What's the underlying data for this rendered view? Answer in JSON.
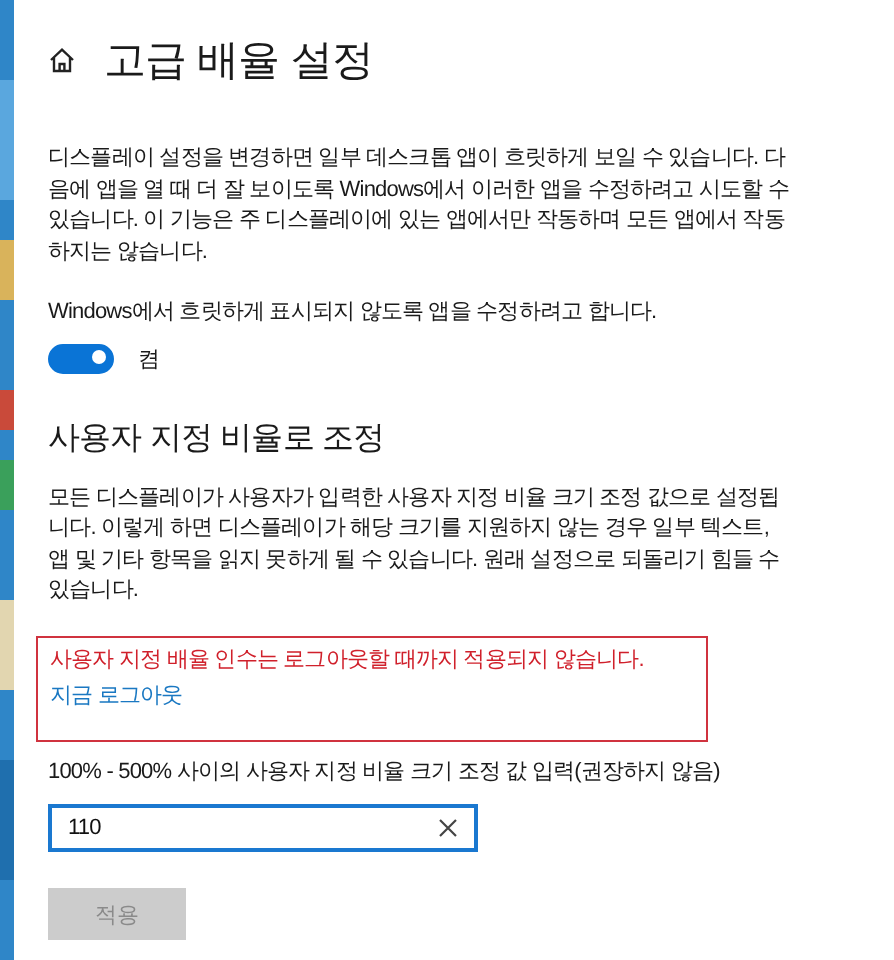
{
  "window": {
    "title": "고급 배율 설정"
  },
  "fix_apps": {
    "description": "디스플레이 설정을 변경하면 일부 데스크톱 앱이 흐릿하게 보일 수 있습니다. 다음에 앱을 열 때 더 잘 보이도록 Windows에서 이러한 앱을 수정하려고 시도할 수 있습니다. 이 기능은 주 디스플레이에 있는 앱에서만 작동하며 모든 앱에서 작동하지는 않습니다.",
    "toggle": {
      "label": "Windows에서 흐릿하게 표시되지 않도록 앱을 수정하려고 합니다.",
      "on": true,
      "state_text": "켬"
    }
  },
  "custom_scaling": {
    "heading": "사용자 지정 비율로 조정",
    "description": "모든 디스플레이가 사용자가 입력한 사용자 지정 비율 크기 조정 값으로 설정됩니다. 이렇게 하면 디스플레이가 해당 크기를 지원하지 않는 경우 일부 텍스트, 앱 및 기타 항목을 읽지 못하게 될 수 있습니다. 원래 설정으로 되돌리기 힘들 수 있습니다.",
    "warning": {
      "message": "사용자 지정 배율 인수는 로그아웃할 때까지 적용되지 않습니다.",
      "link": "지금 로그아웃"
    },
    "input": {
      "label": "100% - 500% 사이의 사용자 지정 비율 크기 조정 값 입력(권장하지 않음)",
      "value": "110"
    },
    "apply_button": {
      "label": "적용",
      "disabled": true
    }
  }
}
